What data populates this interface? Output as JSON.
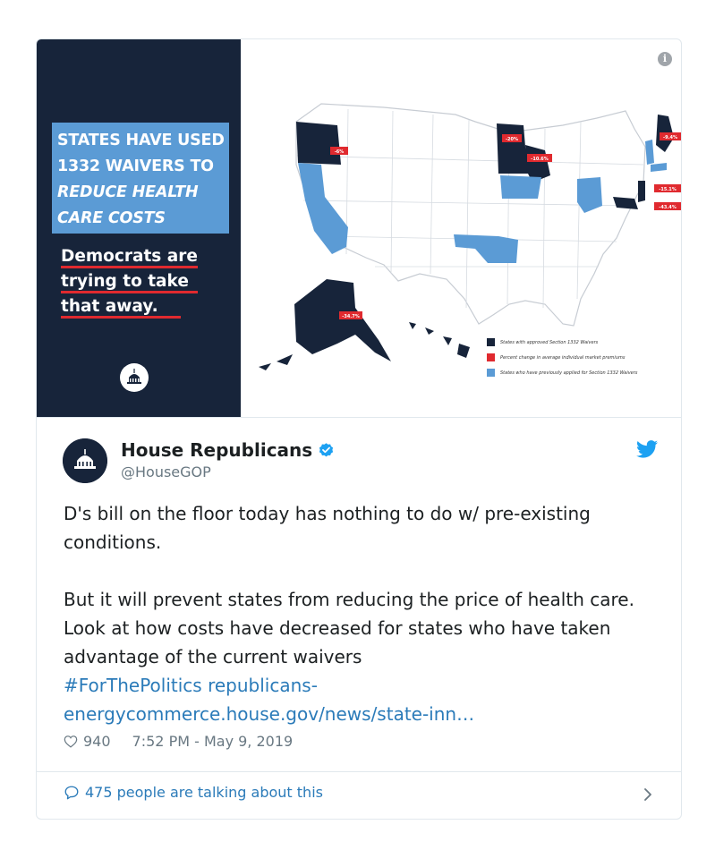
{
  "media": {
    "headline_lines": [
      "STATES HAVE USED",
      "1332 WAIVERS TO",
      "REDUCE HEALTH",
      "CARE COSTS"
    ],
    "sub_lines": [
      "Democrats are",
      "trying to take",
      "that away."
    ],
    "map_labels": {
      "oregon": "-6%",
      "minnesota": "-20%",
      "wisconsin": "-10.6%",
      "maine": "-9.4%",
      "new_jersey": "-15.1%",
      "maryland": "-43.4%",
      "alaska": "-34.7%"
    },
    "legend": [
      {
        "label": "States with approved Section 1332 Waivers",
        "color": "#17243a"
      },
      {
        "label": "Percent change in average individual market premiums",
        "color": "#e02a2f"
      },
      {
        "label": "States who have previously applied for Section 1332 Waivers",
        "color": "#5b9bd5"
      }
    ],
    "info_icon": "info-icon"
  },
  "tweet": {
    "name": "House Republicans",
    "handle": "@HouseGOP",
    "paragraph1": "D's bill on the floor today has nothing to do w/ pre-existing conditions.",
    "paragraph2": "But it will prevent states from reducing the price of health care. Look at how costs have decreased for states who have taken advantage of the current waivers",
    "hashtag": "#ForThePolitics",
    "url": "republicans-energycommerce.house.gov/news/state-inn…",
    "likes": "940",
    "timestamp": "7:52 PM - May 9, 2019",
    "talking": "475 people are talking about this"
  },
  "colors": {
    "navy": "#17243a",
    "light_blue": "#5b9bd5",
    "red": "#e02a2f",
    "link": "#2b7bb9",
    "twitter_blue": "#1da1f2"
  }
}
